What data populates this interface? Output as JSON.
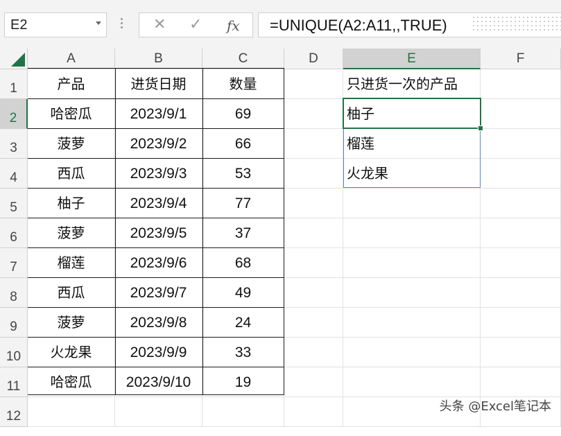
{
  "formula_bar": {
    "name_box": "E2",
    "cancel_icon": "✕",
    "enter_icon": "✓",
    "fx_label": "fx",
    "formula": "=UNIQUE(A2:A11,,TRUE)"
  },
  "columns": [
    "A",
    "B",
    "C",
    "D",
    "E",
    "F"
  ],
  "rows": [
    "1",
    "2",
    "3",
    "4",
    "5",
    "6",
    "7",
    "8",
    "9",
    "10",
    "11",
    "12"
  ],
  "headers": {
    "product": "产品",
    "date": "进货日期",
    "qty": "数量",
    "result": "只进货一次的产品"
  },
  "table": [
    {
      "product": "哈密瓜",
      "date": "2023/9/1",
      "qty": "69"
    },
    {
      "product": "菠萝",
      "date": "2023/9/2",
      "qty": "66"
    },
    {
      "product": "西瓜",
      "date": "2023/9/3",
      "qty": "53"
    },
    {
      "product": "柚子",
      "date": "2023/9/4",
      "qty": "77"
    },
    {
      "product": "菠萝",
      "date": "2023/9/5",
      "qty": "37"
    },
    {
      "product": "榴莲",
      "date": "2023/9/6",
      "qty": "68"
    },
    {
      "product": "西瓜",
      "date": "2023/9/7",
      "qty": "49"
    },
    {
      "product": "菠萝",
      "date": "2023/9/8",
      "qty": "24"
    },
    {
      "product": "火龙果",
      "date": "2023/9/9",
      "qty": "33"
    },
    {
      "product": "哈密瓜",
      "date": "2023/9/10",
      "qty": "19"
    }
  ],
  "unique_results": [
    "柚子",
    "榴莲",
    "火龙果"
  ],
  "watermark": "头条 @Excel笔记本",
  "colors": {
    "accent": "#217346",
    "spill_border": "#5b86c9"
  }
}
